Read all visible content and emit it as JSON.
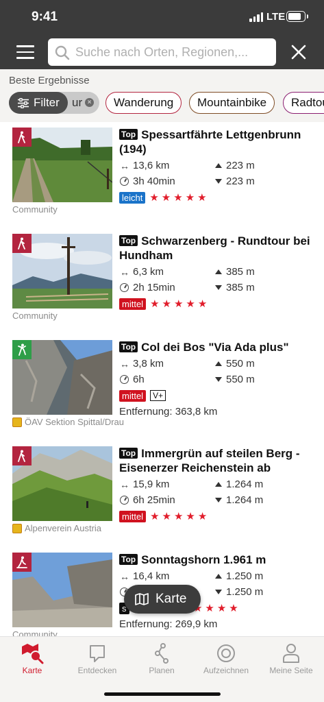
{
  "status": {
    "time": "9:41",
    "network": "LTE"
  },
  "search": {
    "placeholder": "Suche nach Orten, Regionen,..."
  },
  "filters": {
    "section_title": "Beste Ergebnisse",
    "filter_label": "Filter",
    "hidden_chip_fragment": "ur",
    "chips": [
      "Wanderung",
      "Mountainbike",
      "Radtour"
    ]
  },
  "tours": [
    {
      "category": "hiking",
      "top_label": "Top",
      "title": "Spessartfährte Lettgenbrunn (194)",
      "distance": "13,6 km",
      "duration": "3h 40min",
      "ascent": "223 m",
      "descent": "223 m",
      "difficulty": "leicht",
      "difficulty_color": "#1a73c9",
      "rating": "★★★★★",
      "grade": "",
      "extra": "",
      "source": "Community"
    },
    {
      "category": "hiking",
      "top_label": "Top",
      "title": "Schwarzenberg - Rundtour bei Hundham",
      "distance": "6,3 km",
      "duration": "2h 15min",
      "ascent": "385 m",
      "descent": "385 m",
      "difficulty": "mittel",
      "difficulty_color": "#d0121f",
      "rating": "★★★★★",
      "grade": "",
      "extra": "",
      "source": "Community"
    },
    {
      "category": "via-ferrata",
      "top_label": "Top",
      "title": "Col dei Bos \"Via Ada plus\"",
      "distance": "3,8 km",
      "duration": "6h",
      "ascent": "550 m",
      "descent": "550 m",
      "difficulty": "mittel",
      "difficulty_color": "#d0121f",
      "rating": "",
      "grade": "V+",
      "extra": "Entfernung: 363,8 km",
      "source": "ÖAV Sektion Spittal/Drau"
    },
    {
      "category": "hiking",
      "top_label": "Top",
      "title": "Immergrün auf steilen Berg - Eisenerzer Reichenstein ab",
      "distance": "15,9 km",
      "duration": "6h 25min",
      "ascent": "1.264 m",
      "descent": "1.264 m",
      "difficulty": "mittel",
      "difficulty_color": "#d0121f",
      "rating": "★★★★★",
      "grade": "",
      "extra": "",
      "source": "Alpenverein Austria"
    },
    {
      "category": "mountaineering",
      "top_label": "Top",
      "title": "Sonntagshorn 1.961 m",
      "distance": "16,4 km",
      "duration": "",
      "ascent": "1.250 m",
      "descent": "1.250 m",
      "difficulty": "s",
      "difficulty_color": "#111111",
      "rating": "★★★★★",
      "grade": "",
      "extra": "Entfernung: 269,9 km",
      "source": "Community"
    }
  ],
  "map_button": "Karte",
  "tabbar": [
    {
      "label": "Karte",
      "icon": "map-search-icon",
      "active": true
    },
    {
      "label": "Entdecken",
      "icon": "speech-bubble-icon",
      "active": false
    },
    {
      "label": "Planen",
      "icon": "route-icon",
      "active": false
    },
    {
      "label": "Aufzeichnen",
      "icon": "record-icon",
      "active": false
    },
    {
      "label": "Meine Seite",
      "icon": "person-icon",
      "active": false
    }
  ],
  "colors": {
    "accent": "#d01b2e",
    "header": "#3b3b3b",
    "hiking_badge": "#b3243f",
    "ferrata_badge": "#2e9e48"
  }
}
